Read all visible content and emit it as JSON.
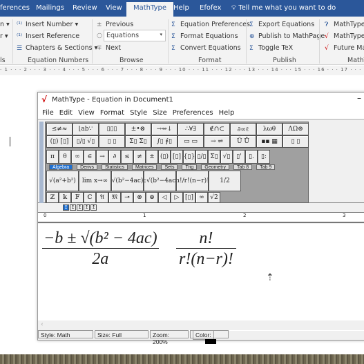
{
  "word": {
    "tabs": [
      "ferences",
      "Mailings",
      "Review",
      "View",
      "MathType",
      "Help",
      "Efofex"
    ],
    "active_tab": "MathType",
    "tell_me": "Tell me what you want to do",
    "ribbon": {
      "left_cut": [
        "n ▾",
        "r ▾",
        "ls"
      ],
      "equation_numbers": {
        "items": [
          "Insert Number",
          "Insert Reference",
          "Chapters & Sections"
        ],
        "label": "Equation Numbers"
      },
      "browse": {
        "previous": "Previous",
        "dropdown": "Equations",
        "next": "Next",
        "label": "Browse"
      },
      "format": {
        "items": [
          "Equation Preferences",
          "Format Equations",
          "Convert Equations"
        ],
        "label": "Format"
      },
      "publish": {
        "items": [
          "Export Equations",
          "Publish to MathPage",
          "Toggle TeX"
        ],
        "label": "Publish"
      },
      "mathtype": {
        "items": [
          "MathType",
          "MathType",
          "Future Ma"
        ],
        "label": "MathT"
      }
    },
    "ruler": "· 1 · · · 2 · · · 3 · · · 4 · · · 5 · · · 6 · · · 7 · · · 8 · · · 9 · · · 10 · · · 11 · · · 12 · · · 13 · · · 14 · · · 15 · · · 16 · · · 17 · · · 18"
  },
  "mathtype": {
    "title": "MathType - Equation in Document1",
    "menu": [
      "File",
      "Edit",
      "View",
      "Format",
      "Style",
      "Size",
      "Preferences",
      "Help"
    ],
    "palette_row1": [
      "≤≠≈",
      "⌊ab∵",
      "▯▯▯",
      "±•⊗",
      "→⇔↓",
      "∴∀∃",
      "∉∩⊂",
      "∂∞ℓ",
      "λωθ",
      "ΛΩ⊛"
    ],
    "palette_row2": [
      "(▯) [▯]",
      "▯/▯ √▯",
      "▯ ▯",
      "Σ▯ Σ▯",
      "∫▯ ∮▯",
      "▭ ▭",
      "→ ⇌",
      "Ũ Ů",
      "▪▪ ▦",
      "▯ ▯"
    ],
    "palette_row3": [
      "π",
      "θ",
      "∞",
      "∈",
      "→",
      "∂",
      "≤",
      "≠",
      "±",
      "(▯)",
      "[▯]",
      "{▯}",
      "▯/▯",
      "Σ▯",
      "√▯",
      "▯'",
      "▯.",
      "▯:"
    ],
    "palette_tabs": [
      "Algebra",
      "Derivs",
      "Statistics",
      "Matrices",
      "Sets",
      "Trig",
      "Geometry",
      "Tab 8",
      "Tab 9"
    ],
    "active_palette_tab": "Algebra",
    "templates": [
      "√(a²+b²)",
      "lim x→∞",
      "√(b²−4ac)",
      "(−b±√(b²−4ac))/2a",
      "n!/r!(n−r)!",
      "1/2"
    ],
    "palette_row_bottom": [
      "ℤ",
      "𝕜",
      "𝔽",
      "ℂ",
      "𝔄",
      "𝔐",
      "⊸",
      "⊗",
      "⊕",
      "◁",
      "▷",
      "[▯]",
      "∞",
      "√2"
    ],
    "tab_stops": [
      "↥",
      "↥",
      "↥",
      "↥",
      "↥"
    ],
    "ruler_marks": [
      "0",
      "1",
      "2",
      "3"
    ],
    "equation1": {
      "numerator": "−b ± √(b² − 4ac)",
      "num_a": "−b ± ",
      "num_rad": "b",
      "num_rad_exp": "2",
      "num_rest": " − 4ac",
      "denominator": "2a"
    },
    "equation2": {
      "numerator": "n!",
      "denominator": "r!(n−r)!"
    },
    "status": {
      "style": "Style: Math",
      "size": "Size: Full",
      "zoom": "Zoom: 200%",
      "color": "Color:"
    },
    "color_value": "#000000"
  }
}
